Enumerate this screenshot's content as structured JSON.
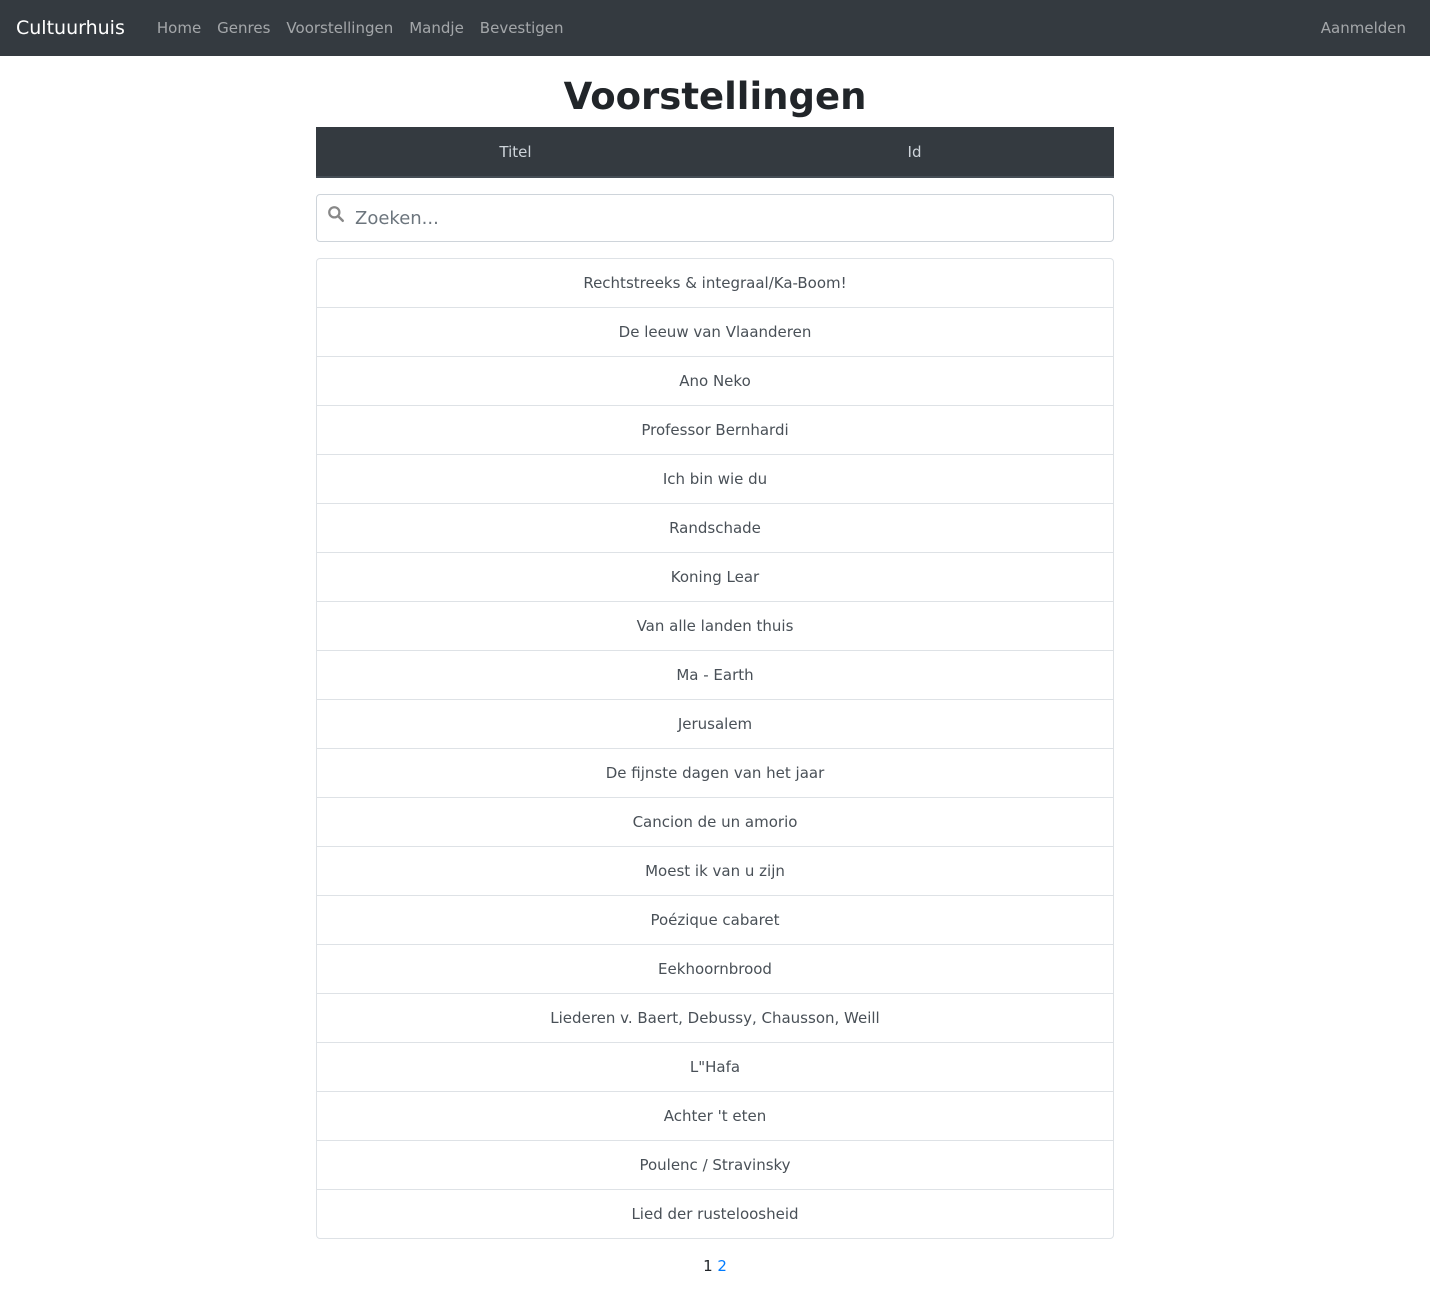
{
  "nav": {
    "brand": "Cultuurhuis",
    "links": [
      "Home",
      "Genres",
      "Voorstellingen",
      "Mandje",
      "Bevestigen"
    ],
    "login": "Aanmelden"
  },
  "page": {
    "title": "Voorstellingen"
  },
  "table": {
    "headers": [
      "Titel",
      "Id"
    ]
  },
  "search": {
    "placeholder": "Zoeken...",
    "value": ""
  },
  "items": [
    "Rechtstreeks & integraal/Ka-Boom!",
    "De leeuw van Vlaanderen",
    "Ano Neko",
    "Professor Bernhardi",
    "Ich bin wie du",
    "Randschade",
    "Koning Lear",
    "Van alle landen thuis",
    "Ma - Earth",
    "Jerusalem",
    "De fijnste dagen van het jaar",
    "Cancion de un amorio",
    "Moest ik van u zijn",
    "Poézique cabaret",
    "Eekhoornbrood",
    "Liederen v. Baert, Debussy, Chausson, Weill",
    "L\"Hafa",
    "Achter 't eten",
    "Poulenc / Stravinsky",
    "Lied der rusteloosheid"
  ],
  "pagination": {
    "current": "1",
    "next": "2"
  },
  "colors": {
    "navbar": "#343a40",
    "link": "#007bff"
  }
}
